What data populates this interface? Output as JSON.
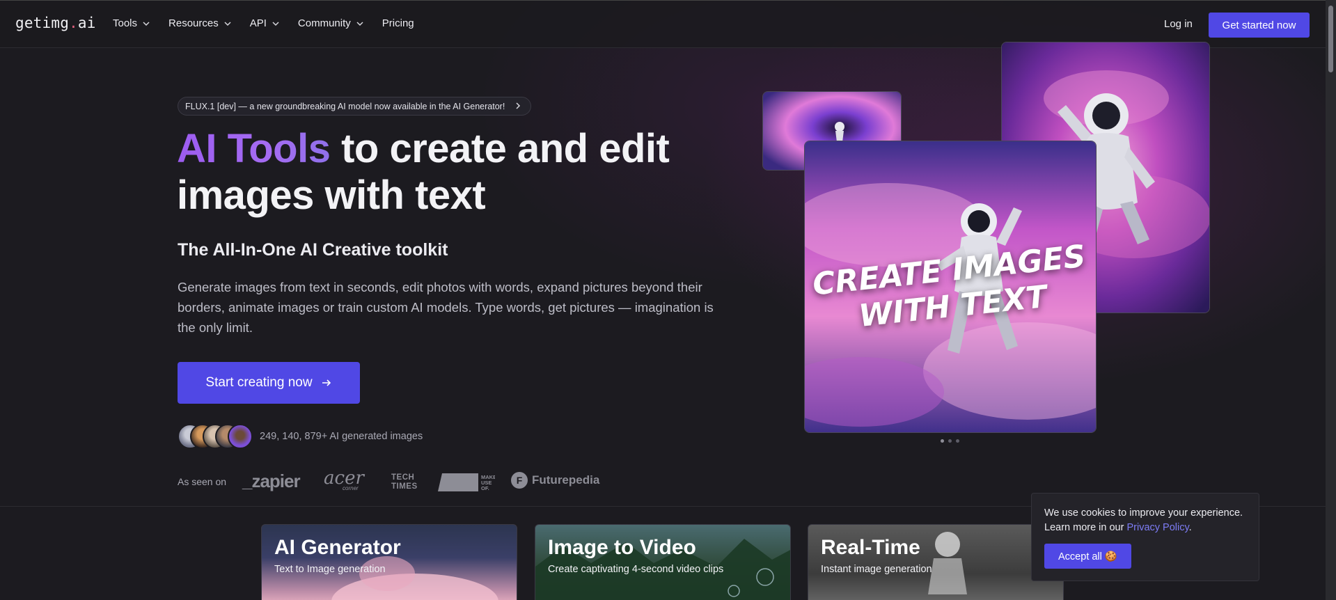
{
  "header": {
    "logo_prefix": "getimg",
    "logo_dot": ".",
    "logo_suffix": "ai",
    "nav": [
      {
        "label": "Tools"
      },
      {
        "label": "Resources"
      },
      {
        "label": "API"
      },
      {
        "label": "Community"
      },
      {
        "label": "Pricing"
      }
    ],
    "login_label": "Log in",
    "cta_label": "Get started now"
  },
  "hero": {
    "announcement": "FLUX.1 [dev] — a new groundbreaking AI model now available in the AI Generator!",
    "title_highlight": "AI Tools",
    "title_rest": " to create and edit images with text",
    "subtitle": "The All-In-One AI Creative toolkit",
    "description": "Generate images from text in seconds, edit photos with words, expand pictures beyond their borders, animate images or train custom AI models. Type words, get pictures — imagination is the only limit.",
    "start_button": "Start creating now",
    "generated_count": "249, 140, 879+ AI generated images",
    "seen_on_label": "As seen on",
    "brands": {
      "zapier": "_zapier",
      "acer": "acer",
      "acer_sub": "corner",
      "techtimes_line1": "TECH",
      "techtimes_line2": "TIMES",
      "muo_line1": "MAKE",
      "muo_line2": "USE",
      "muo_line3": "OF.",
      "futurepedia": "Futurepedia"
    },
    "image_caption_line1": "CREATE IMAGES",
    "image_caption_line2": "WITH TEXT"
  },
  "tools": [
    {
      "title": "AI Generator",
      "subtitle": "Text to Image generation"
    },
    {
      "title": "Image to Video",
      "subtitle": "Create captivating 4-second video clips"
    },
    {
      "title": "Real-Time",
      "subtitle": "Instant image generation"
    }
  ],
  "cookie": {
    "text_before": "We use cookies to improve your experience. Learn more in our ",
    "link": "Privacy Policy",
    "text_after": ".",
    "accept_label": "Accept all 🍪"
  },
  "colors": {
    "accent": "#5048e5",
    "title_gradient_start": "#9c5cf0",
    "link": "#7d7cf5",
    "background": "#1c1b20"
  }
}
